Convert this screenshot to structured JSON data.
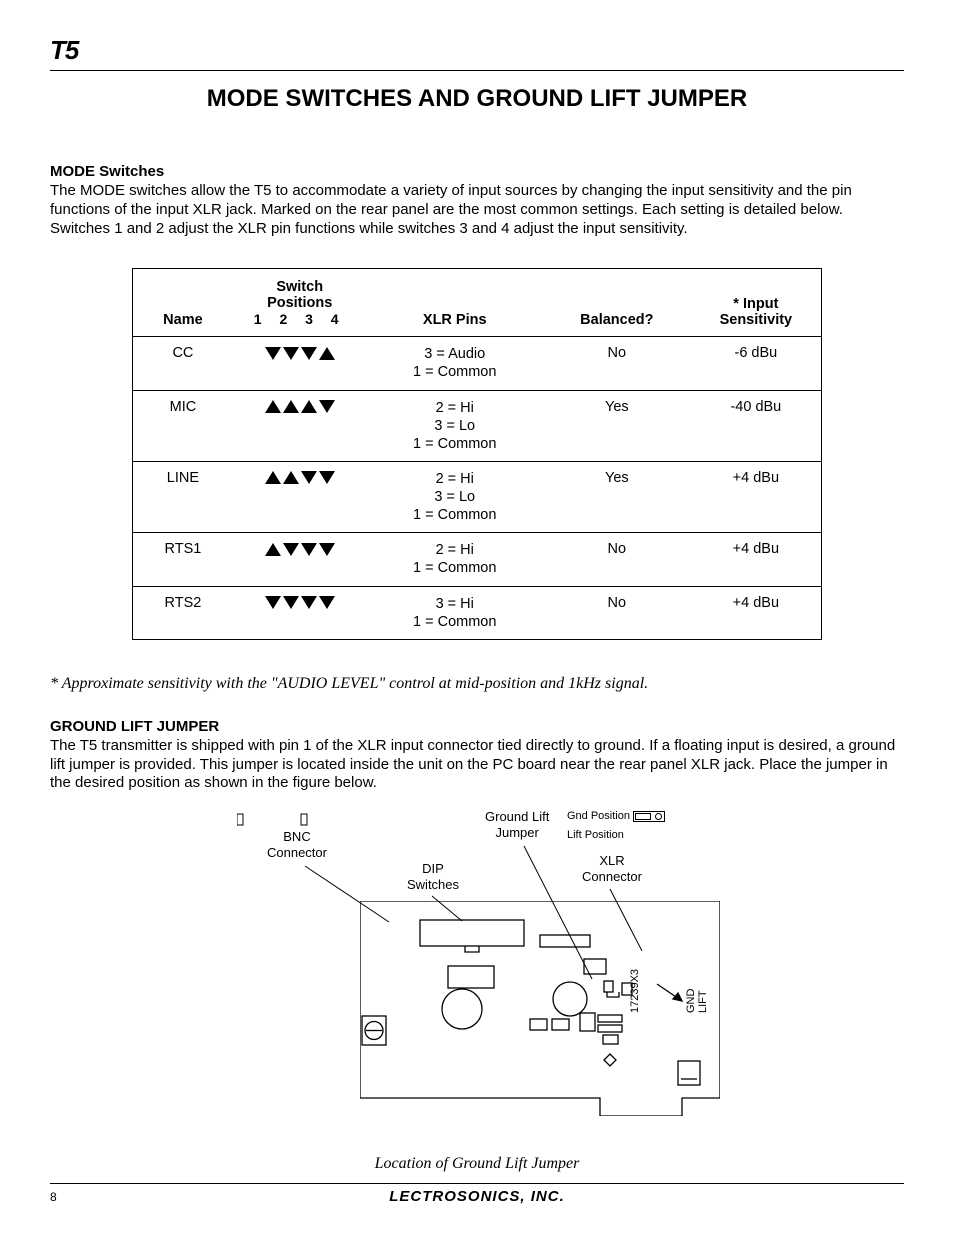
{
  "header": {
    "model": "T5"
  },
  "title": "MODE SWITCHES AND GROUND LIFT JUMPER",
  "section1": {
    "heading": "MODE Switches",
    "text": "The MODE switches allow the T5 to accommodate a variety of input sources by changing the input sensitivity and the pin functions of the input XLR jack.  Marked on the rear panel are the most common settings.  Each setting is detailed below.  Switches 1 and 2 adjust the XLR pin functions while switches 3 and 4 adjust the input sensitivity."
  },
  "table": {
    "head": {
      "name": "Name",
      "positions_l1": "Switch",
      "positions_l2": "Positions",
      "positions_nums": "1  2  3  4",
      "pins": "XLR Pins",
      "balanced": "Balanced?",
      "sens_l1": "* Input",
      "sens_l2": "Sensitivity"
    },
    "rows": [
      {
        "name": "CC",
        "pattern": [
          "dn",
          "dn",
          "dn",
          "up"
        ],
        "pins": "3 = Audio\n1 = Common",
        "balanced": "No",
        "sens": "-6 dBu"
      },
      {
        "name": "MIC",
        "pattern": [
          "up",
          "up",
          "up",
          "dn"
        ],
        "pins": "2 = Hi\n3 = Lo\n1 = Common",
        "balanced": "Yes",
        "sens": "-40 dBu"
      },
      {
        "name": "LINE",
        "pattern": [
          "up",
          "up",
          "dn",
          "dn"
        ],
        "pins": "2 = Hi\n3 = Lo\n1 = Common",
        "balanced": "Yes",
        "sens": "+4 dBu"
      },
      {
        "name": "RTS1",
        "pattern": [
          "up",
          "dn",
          "dn",
          "dn"
        ],
        "pins": "2 = Hi\n1 = Common",
        "balanced": "No",
        "sens": "+4 dBu"
      },
      {
        "name": "RTS2",
        "pattern": [
          "dn",
          "dn",
          "dn",
          "dn"
        ],
        "pins": "3 = Hi\n1 = Common",
        "balanced": "No",
        "sens": "+4 dBu"
      }
    ]
  },
  "footnote": "* Approximate sensitivity with the \"AUDIO LEVEL\" control at mid-position and 1kHz signal.",
  "section2": {
    "heading": "GROUND LIFT JUMPER",
    "text": "The T5 transmitter is shipped with pin 1 of the XLR input connector tied directly to ground.  If a floating input is desired, a ground lift jumper is provided.  This jumper is located inside the unit on the PC board near the rear panel XLR jack.  Place the jumper in the desired position as shown in the figure below."
  },
  "diagram": {
    "bnc": "BNC\nConnector",
    "dip": "DIP\nSwitches",
    "glj": "Ground Lift\nJumper",
    "xlr": "XLR\nConnector",
    "gndpos": "Gnd Position",
    "liftpos": "Lift Position",
    "boardnum": "17239X3",
    "gnd": "GND",
    "lift": "LIFT",
    "caption": "Location of Ground Lift Jumper"
  },
  "footer": {
    "page": "8",
    "company": "LECTROSONICS, INC."
  }
}
